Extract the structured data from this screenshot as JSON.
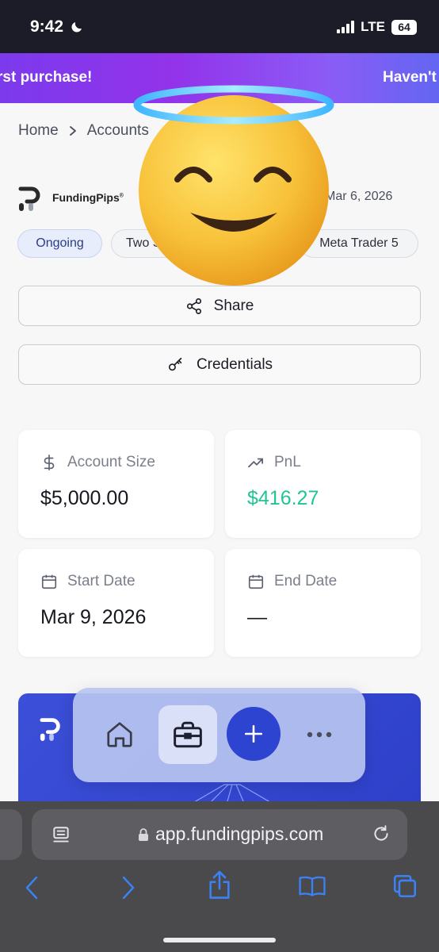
{
  "status": {
    "time": "9:42",
    "network": "LTE",
    "battery": "64"
  },
  "promo": {
    "left_text": "rst purchase!",
    "right_text": "Haven't"
  },
  "breadcrumb": {
    "home": "Home",
    "accounts": "Accounts"
  },
  "account": {
    "brand": "FundingPips",
    "date": "Mar 6, 2026",
    "chips": [
      "Ongoing",
      "Two S",
      "Meta Trader 5"
    ]
  },
  "buttons": {
    "share": "Share",
    "credentials": "Credentials"
  },
  "stats": {
    "account_size": {
      "label": "Account Size",
      "value": "$5,000.00"
    },
    "pnl": {
      "label": "PnL",
      "value": "$416.27",
      "color": "#22c497"
    },
    "start_date": {
      "label": "Start Date",
      "value": "Mar 9, 2026"
    },
    "end_date": {
      "label": "End Date",
      "value": "—"
    }
  },
  "tabbar": {
    "active": "accounts",
    "accent": "#2d44d0"
  },
  "browser": {
    "url": "app.fundingpips.com"
  },
  "icons": {
    "moon": "moon-icon",
    "signal": "signal-icon",
    "chevron": "chevron-right-icon",
    "share": "share-icon",
    "key": "key-icon",
    "dollar": "dollar-icon",
    "trend": "trending-up-icon",
    "calendar": "calendar-icon",
    "home": "home-icon",
    "briefcase": "briefcase-icon",
    "plus": "plus-icon",
    "more": "more-icon",
    "lock": "lock-icon",
    "reader": "reader-icon",
    "reload": "reload-icon",
    "back": "back-icon",
    "forward": "forward-icon",
    "upload": "share-upload-icon",
    "book": "bookmarks-icon",
    "tabs": "tabs-icon",
    "emoji": "smiling-face-with-halo-emoji"
  }
}
